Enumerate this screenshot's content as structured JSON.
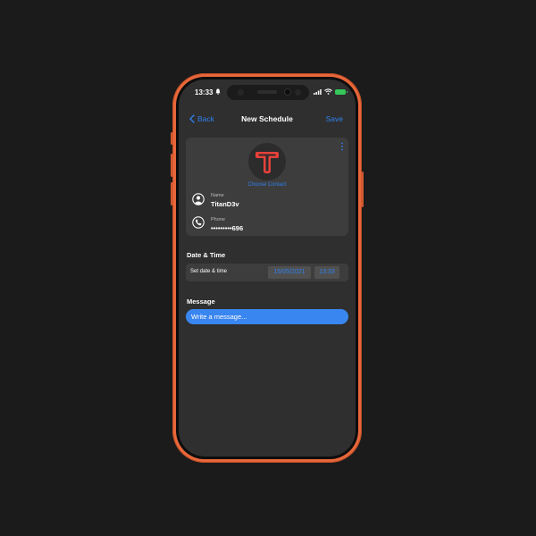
{
  "status_bar": {
    "time": "13:33",
    "icons": [
      "bell-icon",
      "signal-icon",
      "wifi-icon",
      "battery-icon"
    ]
  },
  "nav": {
    "back_label": "Back",
    "title": "New Schedule",
    "save_label": "Save"
  },
  "contact": {
    "choose_label": "Choose Contact",
    "name_label": "Name",
    "name_value": "TitanD3v",
    "phone_label": "Phone",
    "phone_value": "•••••••••696",
    "logo_letter": "T"
  },
  "datetime": {
    "section_title": "Date & Time",
    "row_label": "Set date & time",
    "date": "15/05/2021",
    "time": "13:33"
  },
  "message": {
    "section_title": "Message",
    "placeholder": "Write a message..."
  },
  "colors": {
    "accent": "#2f80ed",
    "frame": "#e8673a",
    "logo": "#e8413a",
    "background": "#1b1b1b",
    "screen": "#2f2f2f",
    "card": "#3d3d3d"
  }
}
